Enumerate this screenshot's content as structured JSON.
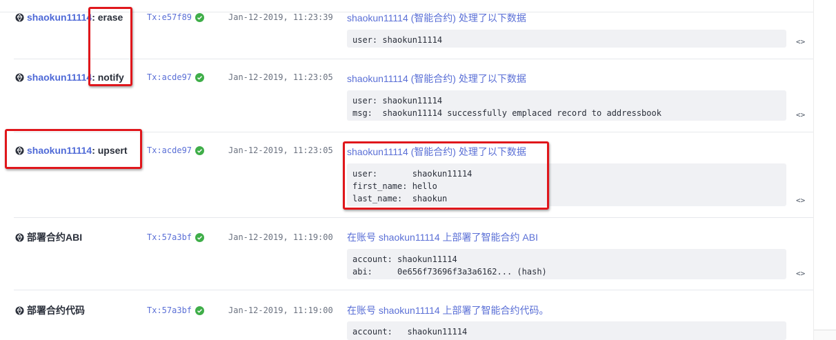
{
  "rows": [
    {
      "action_actor": "shaokun11114",
      "action_name": ": erase",
      "tx": "Tx:e57f89",
      "time": "Jan-12-2019, 11:23:39",
      "desc_account": "shaokun11114",
      "desc_suffix": " (智能合约) 处理了以下数据",
      "data": [
        [
          "user: ",
          "shaokun11114"
        ]
      ],
      "toggle": "<>"
    },
    {
      "action_actor": "shaokun11114",
      "action_name": ": notify",
      "tx": "Tx:acde97",
      "time": "Jan-12-2019, 11:23:05",
      "desc_account": "shaokun11114",
      "desc_suffix": " (智能合约) 处理了以下数据",
      "data": [
        [
          "user: ",
          "shaokun11114"
        ],
        [
          "msg:  ",
          "shaokun11114 successfully emplaced record to addressbook"
        ]
      ],
      "toggle": "<>"
    },
    {
      "action_actor": "shaokun11114",
      "action_name": ": upsert",
      "tx": "Tx:acde97",
      "time": "Jan-12-2019, 11:23:05",
      "desc_account": "shaokun11114",
      "desc_suffix": " (智能合约) 处理了以下数据",
      "data": [
        [
          "user:       ",
          "shaokun11114"
        ],
        [
          "first_name: ",
          "hello"
        ],
        [
          "last_name:  ",
          "shaokun"
        ]
      ],
      "toggle": "<>"
    },
    {
      "action_actor": "",
      "action_name": "部署合约ABI",
      "tx": "Tx:57a3bf",
      "time": "Jan-12-2019, 11:19:00",
      "desc_prefix": "在账号 ",
      "desc_account": "shaokun11114",
      "desc_suffix": " 上部署了智能合约 ABI",
      "data": [
        [
          "account: ",
          "shaokun11114"
        ],
        [
          "abi:     ",
          "0e656f73696f3a3a6162... (hash)"
        ]
      ],
      "toggle": "<>"
    },
    {
      "action_actor": "",
      "action_name": "部署合约代码",
      "tx": "Tx:57a3bf",
      "time": "Jan-12-2019, 11:19:00",
      "desc_prefix": "在账号 ",
      "desc_account": "shaokun11114",
      "desc_suffix": " 上部署了智能合约代码。",
      "data": [
        [
          "account:   ",
          "shaokun11114"
        ]
      ],
      "toggle": ""
    }
  ]
}
